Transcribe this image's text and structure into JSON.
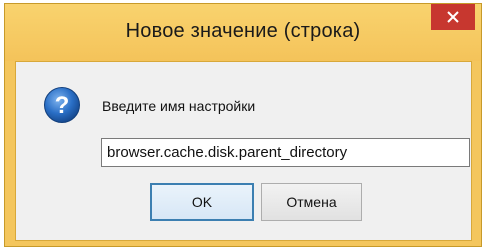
{
  "window": {
    "title": "Новое значение (строка)",
    "close_icon": "close-icon"
  },
  "dialog": {
    "icon": "question-icon",
    "prompt": "Введите имя настройки",
    "input_value": "browser.cache.disk.parent_directory",
    "ok_label": "OK",
    "cancel_label": "Отмена"
  },
  "colors": {
    "title_bar": "#f4c35a",
    "close_button": "#c7372f",
    "icon_blue": "#1f5fb3",
    "ok_border": "#3c7fb1"
  }
}
